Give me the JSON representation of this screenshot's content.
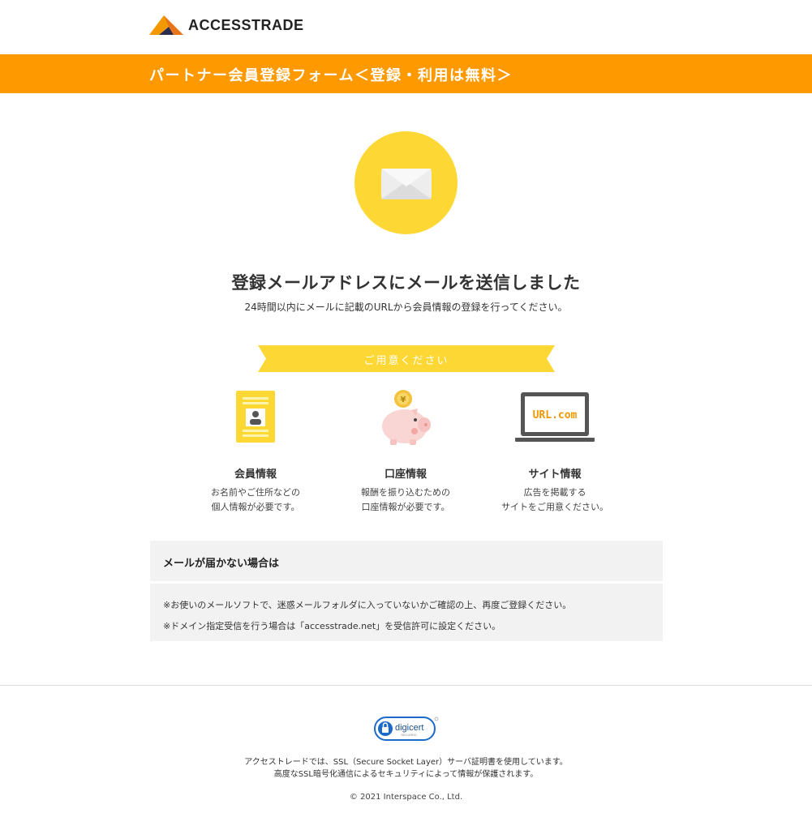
{
  "header": {
    "logo_text": "ACCESSTRADE",
    "brand_color": "#FF9900"
  },
  "banner": {
    "title": "パートナー会員登録フォーム＜登録・利用は無料＞"
  },
  "main": {
    "icon": "envelope-icon",
    "headline": "登録メールアドレスにメールを送信しました",
    "subline": "24時間以内にメールに記載のURLから会員情報の登録を行ってください。",
    "ribbon_label": "ご用意ください",
    "accent_color": "#FDD835"
  },
  "preparations": [
    {
      "icon": "member-card-icon",
      "title": "会員情報",
      "desc_1": "お名前やご住所などの",
      "desc_2": "個人情報が必要です。"
    },
    {
      "icon": "piggy-bank-icon",
      "title": "口座情報",
      "desc_1": "報酬を振り込むための",
      "desc_2": "口座情報が必要です。"
    },
    {
      "icon": "laptop-url-icon",
      "screen_text": "URL.com",
      "title": "サイト情報",
      "desc_1": "広告を掲載する",
      "desc_2": "サイトをご用意ください。"
    }
  ],
  "notice": {
    "title": "メールが届かない場合は",
    "line_1": "※お使いのメールソフトで、迷惑メールフォルダに入っていないかご確認の上、再度ご登録ください。",
    "line_2": "※ドメイン指定受信を行う場合は「accesstrade.net」を受信許可に設定ください。"
  },
  "footer": {
    "seal_text": "digicert",
    "seal_sub": "SECURED",
    "ssl_line_1": "アクセストレードでは、SSL（Secure Socket Layer）サーバ証明書を使用しています。",
    "ssl_line_2": "高度なSSL暗号化通信によるセキュリティによって情報が保護されます。",
    "copyright": "© 2021 Interspace Co., Ltd."
  }
}
